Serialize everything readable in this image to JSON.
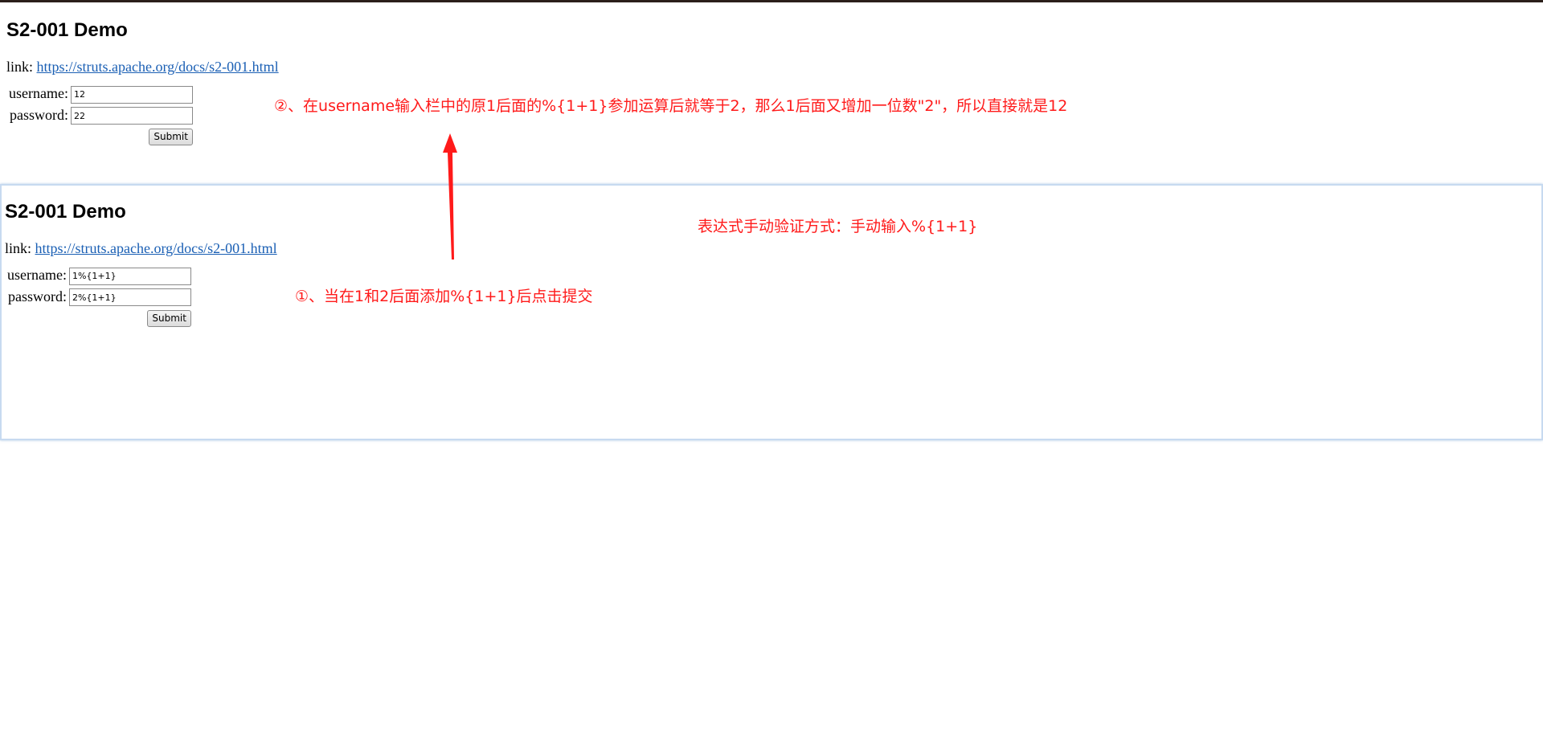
{
  "top_demo": {
    "title": "S2-001 Demo",
    "link_prefix": "link: ",
    "link_text": "https://struts.apache.org/docs/s2-001.html",
    "username_label": "username:",
    "username_value": "12",
    "password_label": "password:",
    "password_value": "22",
    "submit_label": "Submit"
  },
  "bottom_demo": {
    "title": "S2-001 Demo",
    "link_prefix": "link: ",
    "link_text": "https://struts.apache.org/docs/s2-001.html",
    "username_label": "username:",
    "username_value": "1%{1+1}",
    "password_label": "password:",
    "password_value": "2%{1+1}",
    "submit_label": "Submit"
  },
  "annotations": {
    "note_2": "②、在username输入栏中的原1后面的%{1+1}参加运算后就等于2，那么1后面又增加一位数\"2\"，所以直接就是12",
    "note_method": "表达式手动验证方式：手动输入%{1+1}",
    "note_1": "①、当在1和2后面添加%{1+1}后点击提交"
  },
  "colors": {
    "annotation": "#ff1a1a",
    "link": "#1a5fb4"
  }
}
